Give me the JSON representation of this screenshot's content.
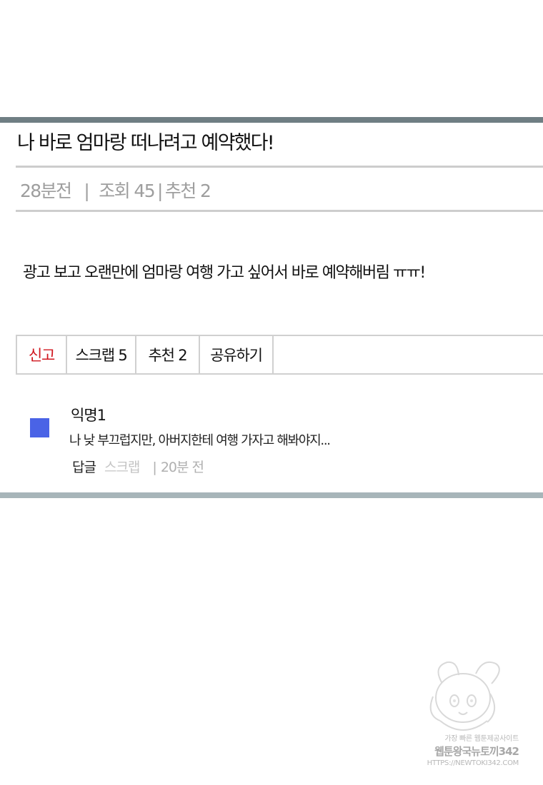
{
  "post": {
    "title": "나 바로 엄마랑 떠나려고 예약했다!",
    "time": "28분전",
    "views_label": "조회",
    "views": "45",
    "recommend_label": "추천",
    "recommend": "2",
    "body": "광고 보고 오랜만에 엄마랑 여행 가고 싶어서 바로 예약해버림 ㅠㅠ!"
  },
  "actions": {
    "report": "신고",
    "scrap": "스크랩 5",
    "recommend": "추천 2",
    "share": "공유하기"
  },
  "comment": {
    "author": "익명1",
    "text": "나 낮 부끄럽지만, 아버지한테 여행 가자고 해봐야지...",
    "reply": "답글",
    "scrap": "스크랩",
    "time": "20분 전"
  },
  "watermark": {
    "line1": "가장 빠른 웹툰제공사이트",
    "line2": "웹툰왕국뉴토끼342",
    "line3": "HTTPS://NEWTOKI342.COM"
  },
  "colors": {
    "top_rule": "#6f7e83",
    "bottom_rule": "#a7b5b9",
    "report_red": "#d0161e",
    "avatar_blue": "#4a63e6"
  }
}
